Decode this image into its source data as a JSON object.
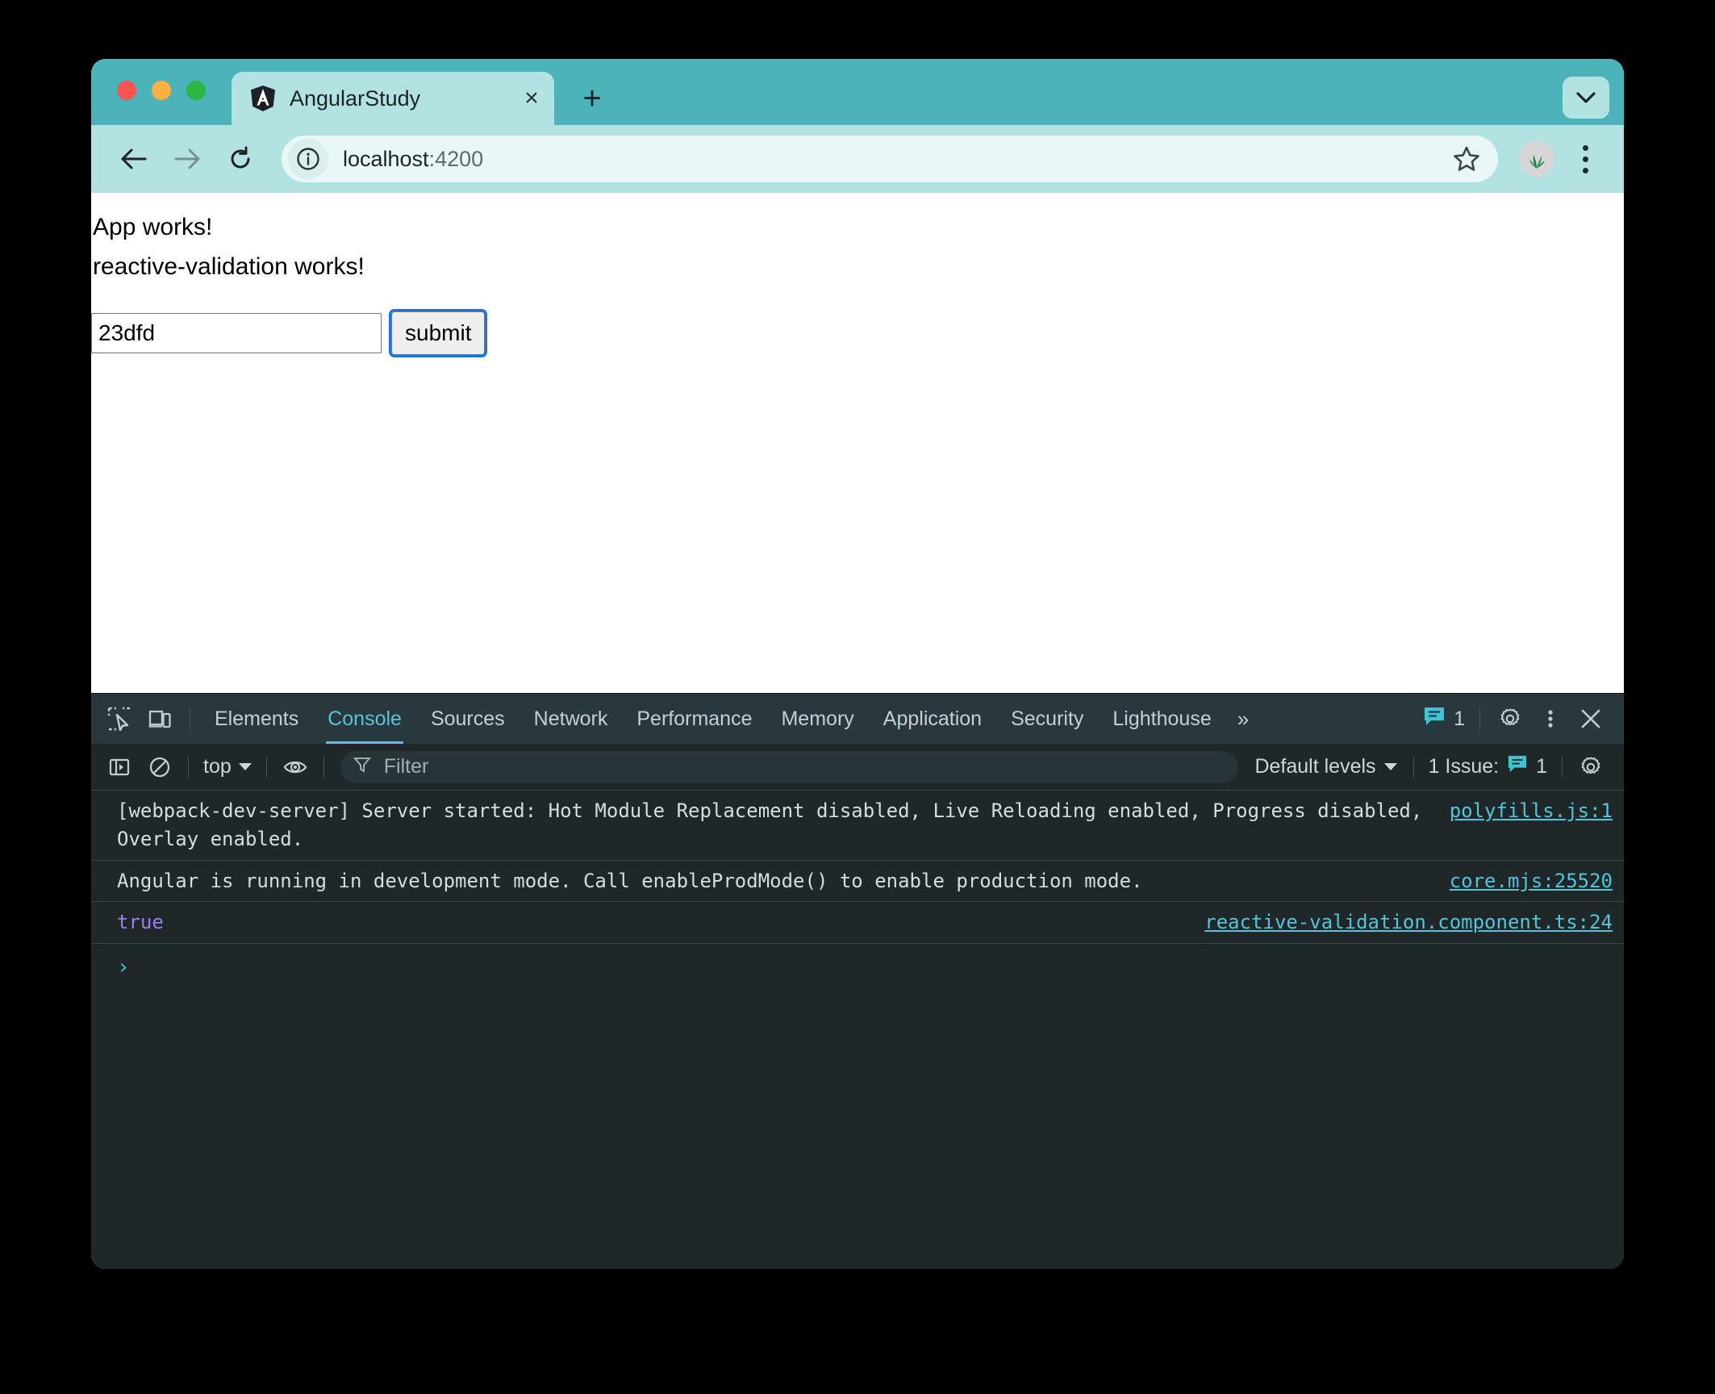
{
  "browser": {
    "tab": {
      "title": "AngularStudy",
      "favicon": "angular-shield-icon",
      "close_label": "×"
    },
    "new_tab_label": "+",
    "tabstrip_menu_icon": "chevron-down-icon",
    "toolbar": {
      "back_icon": "arrow-left-icon",
      "forward_icon": "arrow-right-icon",
      "reload_icon": "reload-icon",
      "info_icon": "info-circle-icon",
      "url_host": "localhost",
      "url_port": ":4200",
      "star_icon": "star-icon",
      "avatar_icon": "profile-avatar",
      "menu_icon": "three-dots-vertical-icon"
    },
    "traffic_lights": [
      "close-red",
      "minimize-amber",
      "maximize-green"
    ]
  },
  "page": {
    "heading_app": "App works!",
    "heading_component": "reactive-validation works!",
    "input_value": "23dfd",
    "input_placeholder": "",
    "submit_label": "submit"
  },
  "devtools": {
    "inspect_icon": "inspect-element-icon",
    "device_icon": "device-toolbar-icon",
    "tabs": [
      {
        "label": "Elements",
        "active": false
      },
      {
        "label": "Console",
        "active": true
      },
      {
        "label": "Sources",
        "active": false
      },
      {
        "label": "Network",
        "active": false
      },
      {
        "label": "Performance",
        "active": false
      },
      {
        "label": "Memory",
        "active": false
      },
      {
        "label": "Application",
        "active": false
      },
      {
        "label": "Security",
        "active": false
      },
      {
        "label": "Lighthouse",
        "active": false
      }
    ],
    "more_tabs_icon": "»",
    "issue_badge_icon": "issue-message-icon",
    "issue_badge_count": "1",
    "settings_icon": "gear-icon",
    "more_options_icon": "three-dots-vertical-icon",
    "close_icon": "close-x-icon",
    "toolbar": {
      "sidebar_icon": "console-sidebar-icon",
      "clear_icon": "clear-console-icon",
      "context_label": "top",
      "eye_icon": "live-expression-eye-icon",
      "filter_icon": "filter-funnel-icon",
      "filter_placeholder": "Filter",
      "levels_label": "Default levels",
      "issues_label": "1 Issue:",
      "issues_icon": "issue-message-icon",
      "issues_count": "1",
      "settings_icon": "gear-icon"
    },
    "messages": [
      {
        "text": "[webpack-dev-server] Server started: Hot Module Replacement disabled, Live Reloading enabled, Progress disabled, Overlay enabled.",
        "source": "polyfills.js:1",
        "kind": "log"
      },
      {
        "text": "Angular is running in development mode. Call enableProdMode() to enable production mode.",
        "source": "core.mjs:25520",
        "kind": "log"
      },
      {
        "text": "true",
        "source": "reactive-validation.component.ts:24",
        "kind": "value"
      }
    ],
    "prompt_symbol": "›"
  },
  "colors": {
    "tabstrip": "#4cb3bb",
    "toolbar": "#b3e2e2",
    "omnibox": "#e9f7f6",
    "devtools_tabbar": "#28383c",
    "devtools_bg": "#1f2728",
    "accent_cyan": "#5bc4d8",
    "link_cyan": "#53c4da",
    "value_purple": "#9a7ff2",
    "focus_blue": "#1a73e8"
  }
}
